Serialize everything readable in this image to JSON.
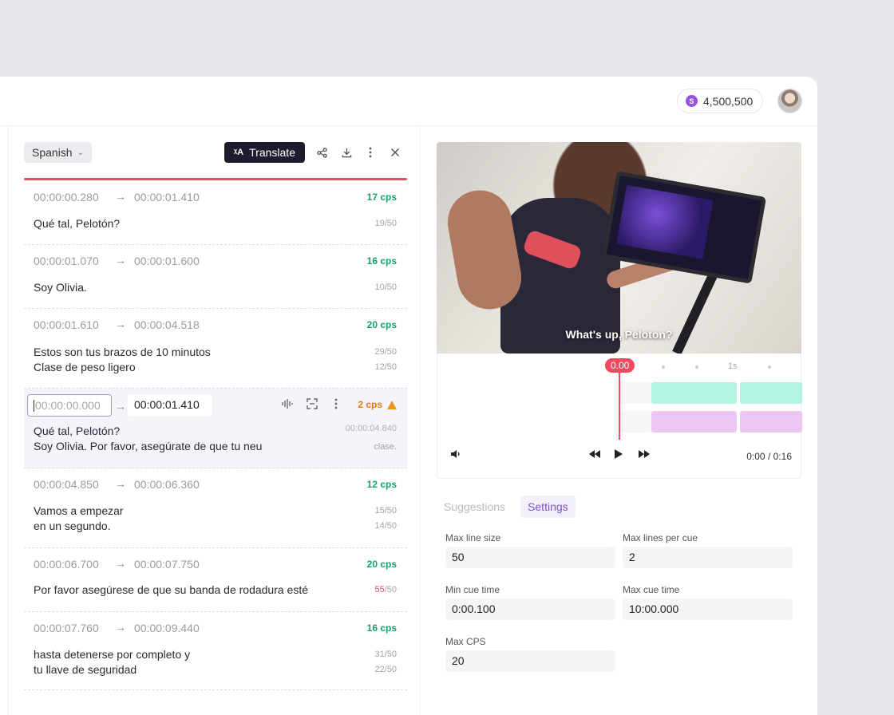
{
  "header": {
    "credits": "4,500,500",
    "coin_symbol": "S"
  },
  "editor": {
    "language": "Spanish",
    "translate_label": "Translate",
    "translate_symbol": "ᵡA",
    "cues": [
      {
        "start": "00:00:00.280",
        "end": "00:00:01.410",
        "cps": "17 cps",
        "lines": [
          "Qué tal, Pelotón?"
        ],
        "counts": [
          "19/50"
        ]
      },
      {
        "start": "00:00:01.070",
        "end": "00:00:01.600",
        "cps": "16 cps",
        "lines": [
          "Soy Olivia."
        ],
        "counts": [
          "10/50"
        ]
      },
      {
        "start": "00:00:01.610",
        "end": "00:00:04.518",
        "cps": "20 cps",
        "lines": [
          "Estos son tus brazos de 10 minutos",
          "Clase de peso ligero"
        ],
        "counts": [
          "29/50",
          "12/50"
        ]
      },
      {
        "start": "00:00:04.850",
        "end": "00:00:06.360",
        "cps": "12 cps",
        "lines": [
          "Vamos a empezar",
          "en un segundo."
        ],
        "counts": [
          "15/50",
          "14/50"
        ]
      },
      {
        "start": "00:00:06.700",
        "end": "00:00:07.750",
        "cps": "20 cps",
        "lines": [
          "Por favor asegúrese de que su banda de rodadura esté"
        ],
        "counts": [
          "55"
        ],
        "count_suffix": "/50"
      },
      {
        "start": "00:00:07.760",
        "end": "00:00:09.440",
        "cps": "16 cps",
        "lines": [
          "hasta detenerse por completo y",
          "tu llave de seguridad"
        ],
        "counts": [
          "31/50",
          "22/50"
        ]
      }
    ],
    "active_cue": {
      "start_placeholder": "00:00:00.000",
      "end": "00:00:01.410",
      "cps": "2 cps",
      "end_time": "00:00:04.840",
      "line1": "Qué tal, Pelotón?",
      "line2": "Soy Olivia. Por favor, asegúrate de que tu neu",
      "line2_suffix": "clase."
    }
  },
  "player": {
    "subtitle": "What's up, Peloton?",
    "playhead_label": "0.00",
    "timeline_mark": "1s",
    "current_time": "0:00",
    "time_separator": "/",
    "duration": "0:16"
  },
  "settings": {
    "tabs": [
      "Suggestions",
      "Settings"
    ],
    "active_tab": "Settings",
    "fields": {
      "max_line_size": {
        "label": "Max line size",
        "value": "50"
      },
      "max_lines_per_cue": {
        "label": "Max lines per cue",
        "value": "2"
      },
      "min_cue_time": {
        "label": "Min cue time",
        "value": "0:00.100"
      },
      "max_cue_time": {
        "label": "Max cue time",
        "value": "10:00.000"
      },
      "max_cps": {
        "label": "Max CPS",
        "value": "20"
      }
    }
  },
  "colors": {
    "accent_red": "#ef4a5f",
    "accent_purple": "#7a4fd3",
    "cps_green": "#12a36b",
    "warn_orange": "#e07a18",
    "dark_button": "#1d1b2e"
  }
}
